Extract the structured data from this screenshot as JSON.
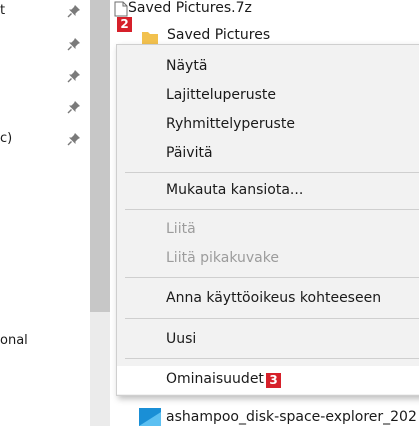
{
  "nav_pane": {
    "items": [
      {
        "text": "t",
        "pinned": true
      },
      {
        "text": "",
        "pinned": true
      },
      {
        "text": "",
        "pinned": true
      },
      {
        "text": "",
        "pinned": true
      },
      {
        "text": "c)",
        "pinned": true
      },
      {
        "text": "onal",
        "pinned": false
      }
    ]
  },
  "files": {
    "item1": "Saved Pictures.7z",
    "item2": "Saved Pictures",
    "item3": "ashampoo_disk-space-explorer_202"
  },
  "badges": {
    "badge2": "2",
    "badge3": "3"
  },
  "context_menu": {
    "items": [
      {
        "label": "Näytä",
        "disabled": false
      },
      {
        "label": "Lajitteluperuste",
        "disabled": false
      },
      {
        "label": "Ryhmittelyperuste",
        "disabled": false
      },
      {
        "label": "Päivitä",
        "disabled": false
      },
      {
        "label": "Mukauta kansiota...",
        "disabled": false
      },
      {
        "label": "Liitä",
        "disabled": true
      },
      {
        "label": "Liitä pikakuvake",
        "disabled": true
      },
      {
        "label": "Anna käyttöoikeus kohteeseen",
        "disabled": false
      },
      {
        "label": "Uusi",
        "disabled": false
      },
      {
        "label": "Ominaisuudet",
        "disabled": false,
        "highlighted": true
      }
    ]
  },
  "colors": {
    "badge": "#d6202a",
    "folder": "#f2c14e",
    "menu_bg": "#f2f2f2",
    "highlight": "#ffffff",
    "disabled_text": "#9c9c9c"
  }
}
